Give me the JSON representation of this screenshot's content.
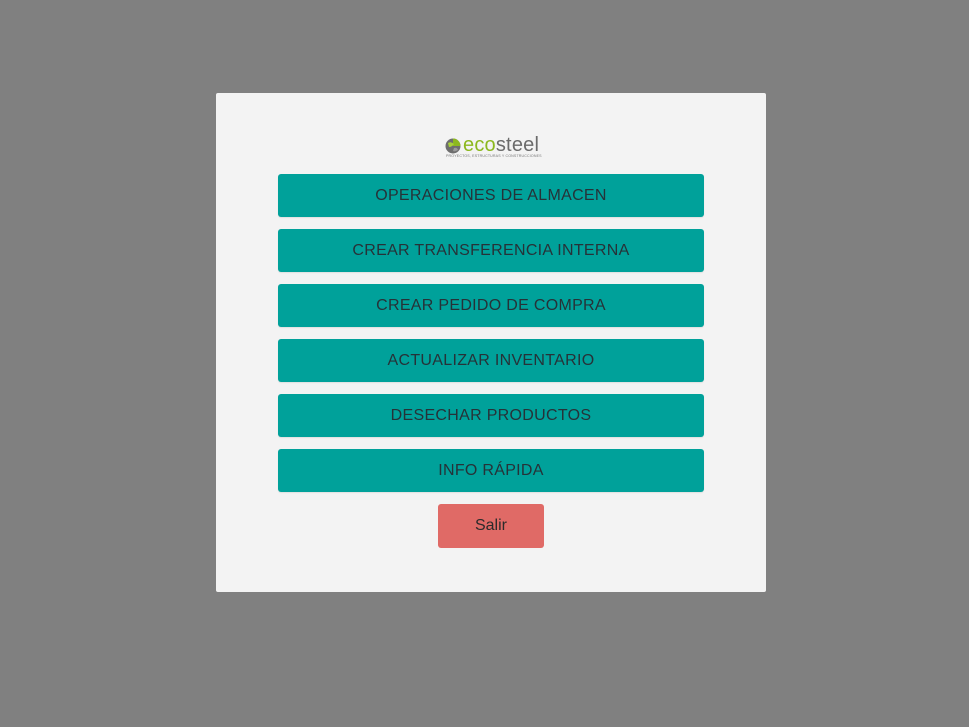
{
  "logo": {
    "eco": "eco",
    "steel": "steel",
    "tagline": "PROYECTOS, ESTRUCTURAS Y CONSTRUCCIONES",
    "brand_green": "#8cb81f",
    "brand_grey": "#6b6b6b"
  },
  "menu": {
    "items": [
      {
        "label": "OPERACIONES DE ALMACEN"
      },
      {
        "label": "CREAR TRANSFERENCIA INTERNA"
      },
      {
        "label": "CREAR PEDIDO DE COMPRA"
      },
      {
        "label": "ACTUALIZAR INVENTARIO"
      },
      {
        "label": "DESECHAR PRODUCTOS"
      },
      {
        "label": "INFO RÁPIDA"
      }
    ]
  },
  "exit": {
    "label": "Salir"
  },
  "colors": {
    "overlay": "#808080",
    "panel": "#f3f3f3",
    "primary_button": "#00a19a",
    "exit_button": "#e06a66"
  }
}
